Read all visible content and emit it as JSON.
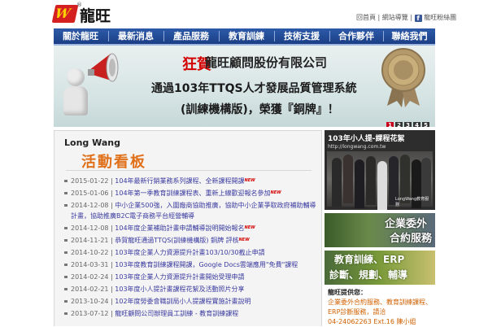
{
  "header": {
    "logo_mark": "W",
    "logo_registered": "®",
    "logo_text": "龍旺",
    "links": [
      "回首頁",
      "網站導覽",
      "龍旺粉絲團"
    ],
    "link_separator": "|",
    "facebook_glyph": "f"
  },
  "nav": {
    "items": [
      "關於龍旺",
      "最新消息",
      "產品服務",
      "教育訓練",
      "技術支援",
      "合作夥伴",
      "聯絡我們"
    ]
  },
  "banner": {
    "headline_prefix": "狂賀",
    "line1": "龍旺顧問股份有限公司",
    "line2": "通過103年TTQS人才發展品質管理系統",
    "line3": "(訓練機構版)，榮獲『銅牌』！",
    "pager": [
      "1",
      "2",
      "3",
      "4",
      "5"
    ],
    "pager_active": "1"
  },
  "news_panel": {
    "brand": "Long Wang",
    "title": "活動看板",
    "new_badge": "NEW",
    "items": [
      {
        "date": "2015-01-22",
        "text": "104年最新行銷業務系列課程、全新課程開課",
        "new": true
      },
      {
        "date": "2015-01-06",
        "text": "104年第一季教育訓練課程表、重新上線歡迎報名參加",
        "new": true
      },
      {
        "date": "2014-12-08",
        "text": "中小企業500強，入圍廠商協助推廣，協助中小企業爭取政府補助輔導計畫，協助推廣B2C電子商務平台經營輔導",
        "new": false
      },
      {
        "date": "2014-12-08",
        "text": "104年度企業補助計畫申請輔導說明開始報名",
        "new": true
      },
      {
        "date": "2014-11-21",
        "text": "恭賀龍旺通過TTQS(訓練機構版) 銅牌 評核",
        "new": true
      },
      {
        "date": "2014-10-22",
        "text": "103年度企業人力資源提升計畫103/10/30截止申請",
        "new": false
      },
      {
        "date": "2014-03-31",
        "text": "103年度教育訓練課程開課，Google Docs雲端應用\"免費\"課程",
        "new": false
      },
      {
        "date": "2014-02-24",
        "text": "103年度企業人力資源提升計畫開始受理申請",
        "new": false
      },
      {
        "date": "2014-02-21",
        "text": "103年度小人提計畫課程花絮及活動照片分享",
        "new": false
      },
      {
        "date": "2013-10-24",
        "text": "102年度勞委會職訓局小人提課程實施計畫說明",
        "new": false
      },
      {
        "date": "2013-07-12",
        "text": "龍旺顧問公司辦理員工訓練 - 教育訓練課程",
        "new": false
      }
    ]
  },
  "side": {
    "promo1_caption": "103年小人提-課程花絮",
    "promo1_url": "http://longwang.com.tw",
    "promo1_watermark": "LongWang教育服務",
    "promo2_line1": "企業委外",
    "promo2_line2": "合約服務",
    "promo3_line1": "教育訓練、ERP",
    "promo3_line2": "診斷、規劃、輔導",
    "provide_label": "龍旺提供您：",
    "services_text": "企業委外合約服務、教育訓練課程、ERP診斷服務，請洽",
    "phone_text": "04-24062263 Ext.16 陳小姐"
  },
  "colors": {
    "nav_bg": "#1b3f86",
    "title_orange": "#e0701a",
    "link_blue": "#3a3aa0",
    "headline_red": "#d40000",
    "pager_active": "#c8001e"
  }
}
